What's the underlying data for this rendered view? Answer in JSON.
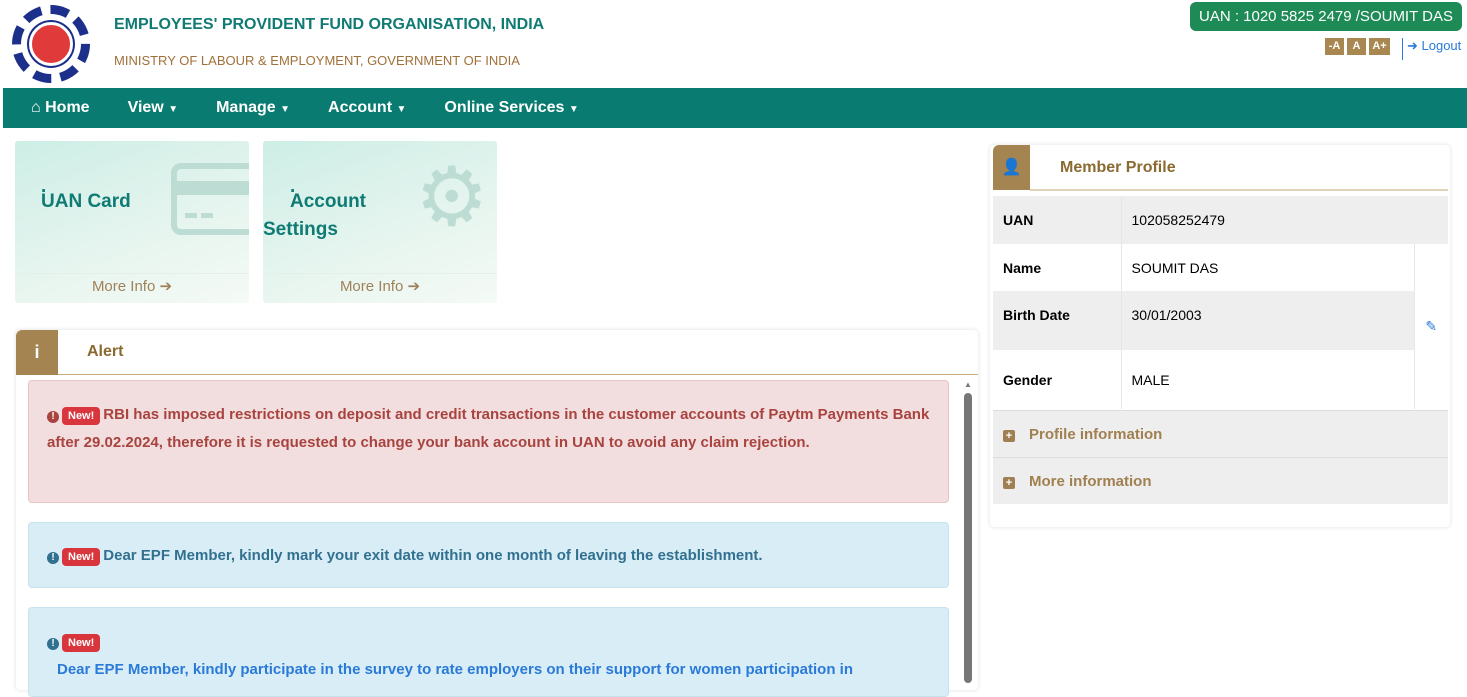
{
  "header": {
    "org": "EMPLOYEES' PROVIDENT FUND ORGANISATION, INDIA",
    "ministry": "MINISTRY OF LABOUR & EMPLOYMENT, GOVERNMENT OF INDIA",
    "uan_badge": "UAN : 1020 5825 2479 /SOUMIT DAS",
    "font_sizes": [
      "-A",
      "A",
      "A+"
    ],
    "logout": "Logout"
  },
  "nav": {
    "items": [
      "Home",
      "View",
      "Manage",
      "Account",
      "Online Services"
    ]
  },
  "tiles": [
    {
      "dot": ".",
      "title": "UAN Card",
      "more": "More Info"
    },
    {
      "dot": ".",
      "title": "Account Settings",
      "more": "More Info"
    }
  ],
  "alert": {
    "title": "Alert",
    "badge": "New!",
    "items": [
      "RBI has imposed restrictions on deposit and credit transactions in the customer accounts of Paytm Payments Bank after 29.02.2024, therefore it is requested to change your bank account in UAN to avoid any claim rejection.",
      "Dear EPF Member, kindly mark your exit date within one month of leaving the establishment.",
      "Dear EPF Member, kindly participate in the survey to rate employers on their support for women participation in"
    ]
  },
  "profile": {
    "title": "Member Profile",
    "rows": [
      {
        "label": "UAN",
        "value": "102058252479"
      },
      {
        "label": "Name",
        "value": "SOUMIT DAS"
      },
      {
        "label": "Birth Date",
        "value": "30/01/2003"
      },
      {
        "label": "Gender",
        "value": "MALE"
      }
    ],
    "sections": [
      "Profile information",
      "More information"
    ]
  },
  "colors": {
    "nav": "#0a7b70",
    "accent": "#a48450",
    "badge": "#1e8a55"
  }
}
